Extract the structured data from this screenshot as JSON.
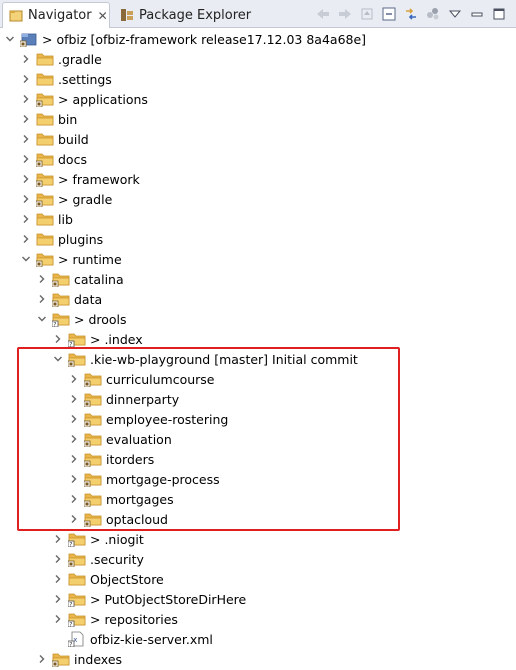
{
  "tabs": [
    {
      "label": "Navigator",
      "close": "✕"
    },
    {
      "label": "Package Explorer"
    }
  ],
  "tree": [
    {
      "label": "> ofbiz [ofbiz-framework release17.12.03 8a4a68e]",
      "depth": 0,
      "expanded": true,
      "icon": "project-icon"
    },
    {
      "label": ".gradle",
      "depth": 1,
      "expanded": false,
      "icon": "folder-icon"
    },
    {
      "label": ".settings",
      "depth": 1,
      "expanded": false,
      "icon": "folder-icon"
    },
    {
      "label": "> applications",
      "depth": 1,
      "expanded": false,
      "icon": "git-folder-icon"
    },
    {
      "label": "bin",
      "depth": 1,
      "expanded": false,
      "icon": "folder-icon"
    },
    {
      "label": "build",
      "depth": 1,
      "expanded": false,
      "icon": "folder-icon"
    },
    {
      "label": "docs",
      "depth": 1,
      "expanded": false,
      "icon": "git-folder-icon"
    },
    {
      "label": "> framework",
      "depth": 1,
      "expanded": false,
      "icon": "git-folder-icon"
    },
    {
      "label": "> gradle",
      "depth": 1,
      "expanded": false,
      "icon": "git-folder-icon"
    },
    {
      "label": "lib",
      "depth": 1,
      "expanded": false,
      "icon": "folder-icon"
    },
    {
      "label": "plugins",
      "depth": 1,
      "expanded": false,
      "icon": "folder-icon"
    },
    {
      "label": "> runtime",
      "depth": 1,
      "expanded": true,
      "icon": "git-folder-icon"
    },
    {
      "label": "catalina",
      "depth": 2,
      "expanded": false,
      "icon": "git-folder-icon"
    },
    {
      "label": "data",
      "depth": 2,
      "expanded": false,
      "icon": "git-folder-icon"
    },
    {
      "label": "> drools",
      "depth": 2,
      "expanded": true,
      "icon": "untracked-folder-icon"
    },
    {
      "label": "> .index",
      "depth": 3,
      "expanded": false,
      "icon": "untracked-folder-icon"
    },
    {
      "label": ".kie-wb-playground [master] Initial commit",
      "depth": 3,
      "expanded": true,
      "icon": "git-folder-icon"
    },
    {
      "label": "curriculumcourse",
      "depth": 4,
      "expanded": false,
      "icon": "git-folder-icon"
    },
    {
      "label": "dinnerparty",
      "depth": 4,
      "expanded": false,
      "icon": "git-folder-icon"
    },
    {
      "label": "employee-rostering",
      "depth": 4,
      "expanded": false,
      "icon": "git-folder-icon"
    },
    {
      "label": "evaluation",
      "depth": 4,
      "expanded": false,
      "icon": "git-folder-icon"
    },
    {
      "label": "itorders",
      "depth": 4,
      "expanded": false,
      "icon": "git-folder-icon"
    },
    {
      "label": "mortgage-process",
      "depth": 4,
      "expanded": false,
      "icon": "git-folder-icon"
    },
    {
      "label": "mortgages",
      "depth": 4,
      "expanded": false,
      "icon": "git-folder-icon"
    },
    {
      "label": "optacloud",
      "depth": 4,
      "expanded": false,
      "icon": "git-folder-icon"
    },
    {
      "label": "> .niogit",
      "depth": 3,
      "expanded": false,
      "icon": "untracked-folder-icon"
    },
    {
      "label": ".security",
      "depth": 3,
      "expanded": false,
      "icon": "git-folder-icon"
    },
    {
      "label": "ObjectStore",
      "depth": 3,
      "expanded": false,
      "icon": "folder-icon"
    },
    {
      "label": "> PutObjectStoreDirHere",
      "depth": 3,
      "expanded": false,
      "icon": "untracked-folder-icon"
    },
    {
      "label": "> repositories",
      "depth": 3,
      "expanded": false,
      "icon": "untracked-folder-icon"
    },
    {
      "label": "ofbiz-kie-server.xml",
      "depth": 3,
      "expanded": null,
      "icon": "xml-file-icon"
    },
    {
      "label": "indexes",
      "depth": 2,
      "expanded": false,
      "icon": "git-folder-icon"
    }
  ],
  "colors": {
    "folder": "#e8b64a",
    "folder_dark": "#c9922a",
    "highlight": "#e02020",
    "twisty": "#666666"
  }
}
